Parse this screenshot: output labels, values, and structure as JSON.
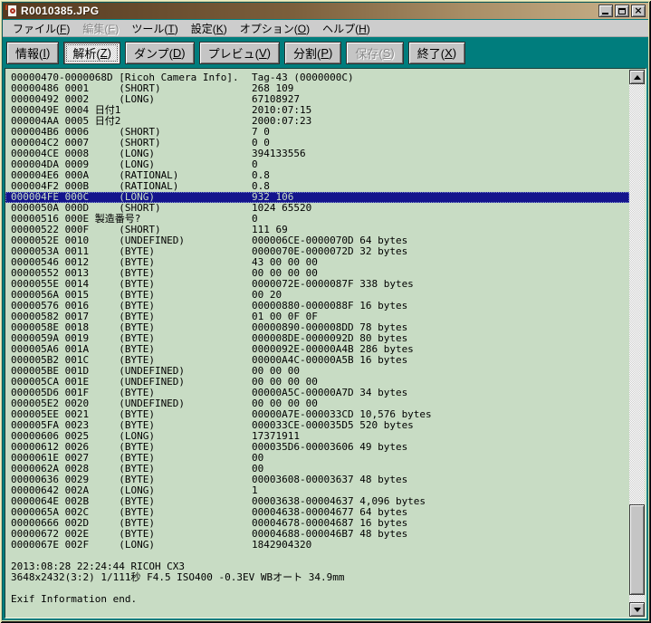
{
  "window": {
    "title": "R0010385.JPG",
    "controls": {
      "close_glyph": "×"
    }
  },
  "colors": {
    "frame_teal": "#007d7d",
    "titlebar_left": "#54391f",
    "titlebar_right": "#c9b28c",
    "menubar_bg": "#cdcdcd",
    "button_face": "#c5c5c5",
    "text_area_bg": "#c8dcc4",
    "selection_bg": "#14148c",
    "selection_fg": "#c8dcc4"
  },
  "menu": {
    "items": [
      {
        "name": "file",
        "pre": "ファイル(",
        "key": "F",
        "post": ")",
        "enabled": true
      },
      {
        "name": "edit",
        "pre": "編集(",
        "key": "E",
        "post": ")",
        "enabled": false
      },
      {
        "name": "tools",
        "pre": "ツール(",
        "key": "T",
        "post": ")",
        "enabled": true
      },
      {
        "name": "settings",
        "pre": "設定(",
        "key": "K",
        "post": ")",
        "enabled": true
      },
      {
        "name": "options",
        "pre": "オプション(",
        "key": "O",
        "post": ")",
        "enabled": true
      },
      {
        "name": "help",
        "pre": "ヘルプ(",
        "key": "H",
        "post": ")",
        "enabled": true
      }
    ]
  },
  "toolbar": {
    "buttons": [
      {
        "name": "info",
        "pre": "情報(",
        "key": "I",
        "post": ")",
        "state": "normal"
      },
      {
        "name": "analyze",
        "pre": "解析(",
        "key": "Z",
        "post": ")",
        "state": "active"
      },
      {
        "name": "dump",
        "pre": "ダンプ(",
        "key": "D",
        "post": ")",
        "state": "normal"
      },
      {
        "name": "preview",
        "pre": "プレビュ(",
        "key": "V",
        "post": ")",
        "state": "normal"
      },
      {
        "name": "split",
        "pre": "分割(",
        "key": "P",
        "post": ")",
        "state": "normal"
      },
      {
        "name": "save",
        "pre": "保存(",
        "key": "S",
        "post": ")",
        "state": "disabled"
      },
      {
        "name": "exit",
        "pre": "終了(",
        "key": "X",
        "post": ")",
        "state": "normal"
      }
    ]
  },
  "content": {
    "rows": [
      [
        "00000470-0000068D [Ricoh Camera Info].",
        "Tag-43 (0000000C)",
        0
      ],
      [
        "00000486 0001     (SHORT)",
        "268 109",
        0
      ],
      [
        "00000492 0002     (LONG)",
        "67108927",
        0
      ],
      [
        "0000049E 0004 日付1",
        "2010:07:15",
        0
      ],
      [
        "000004AA 0005 日付2",
        "2000:07:23",
        0
      ],
      [
        "000004B6 0006     (SHORT)",
        "7 0",
        0
      ],
      [
        "000004C2 0007     (SHORT)",
        "0 0",
        0
      ],
      [
        "000004CE 0008     (LONG)",
        "394133556",
        0
      ],
      [
        "000004DA 0009     (LONG)",
        "0",
        0
      ],
      [
        "000004E6 000A     (RATIONAL)",
        "0.8",
        0
      ],
      [
        "000004F2 000B     (RATIONAL)",
        "0.8",
        0
      ],
      [
        "000004FE 000C     (LONG)",
        "932 106",
        1
      ],
      [
        "0000050A 000D     (SHORT)",
        "1024 65520",
        0
      ],
      [
        "00000516 000E 製造番号?",
        "0",
        0
      ],
      [
        "00000522 000F     (SHORT)",
        "111 69",
        0
      ],
      [
        "0000052E 0010     (UNDEFINED)",
        "000006CE-0000070D 64 bytes",
        0
      ],
      [
        "0000053A 0011     (BYTE)",
        "0000070E-0000072D 32 bytes",
        0
      ],
      [
        "00000546 0012     (BYTE)",
        "43 00 00 00",
        0
      ],
      [
        "00000552 0013     (BYTE)",
        "00 00 00 00",
        0
      ],
      [
        "0000055E 0014     (BYTE)",
        "0000072E-0000087F 338 bytes",
        0
      ],
      [
        "0000056A 0015     (BYTE)",
        "00 20",
        0
      ],
      [
        "00000576 0016     (BYTE)",
        "00000880-0000088F 16 bytes",
        0
      ],
      [
        "00000582 0017     (BYTE)",
        "01 00 0F 0F",
        0
      ],
      [
        "0000058E 0018     (BYTE)",
        "00000890-000008DD 78 bytes",
        0
      ],
      [
        "0000059A 0019     (BYTE)",
        "000008DE-0000092D 80 bytes",
        0
      ],
      [
        "000005A6 001A     (BYTE)",
        "0000092E-00000A4B 286 bytes",
        0
      ],
      [
        "000005B2 001C     (BYTE)",
        "00000A4C-00000A5B 16 bytes",
        0
      ],
      [
        "000005BE 001D     (UNDEFINED)",
        "00 00 00",
        0
      ],
      [
        "000005CA 001E     (UNDEFINED)",
        "00 00 00 00",
        0
      ],
      [
        "000005D6 001F     (BYTE)",
        "00000A5C-00000A7D 34 bytes",
        0
      ],
      [
        "000005E2 0020     (UNDEFINED)",
        "00 00 00 00",
        0
      ],
      [
        "000005EE 0021     (BYTE)",
        "00000A7E-000033CD 10,576 bytes",
        0
      ],
      [
        "000005FA 0023     (BYTE)",
        "000033CE-000035D5 520 bytes",
        0
      ],
      [
        "00000606 0025     (LONG)",
        "17371911",
        0
      ],
      [
        "00000612 0026     (BYTE)",
        "000035D6-00003606 49 bytes",
        0
      ],
      [
        "0000061E 0027     (BYTE)",
        "00",
        0
      ],
      [
        "0000062A 0028     (BYTE)",
        "00",
        0
      ],
      [
        "00000636 0029     (BYTE)",
        "00003608-00003637 48 bytes",
        0
      ],
      [
        "00000642 002A     (LONG)",
        "1",
        0
      ],
      [
        "0000064E 002B     (BYTE)",
        "00003638-00004637 4,096 bytes",
        0
      ],
      [
        "0000065A 002C     (BYTE)",
        "00004638-00004677 64 bytes",
        0
      ],
      [
        "00000666 002D     (BYTE)",
        "00004678-00004687 16 bytes",
        0
      ],
      [
        "00000672 002E     (BYTE)",
        "00004688-000046B7 48 bytes",
        0
      ],
      [
        "0000067E 002F     (LONG)",
        "1842904320",
        0
      ],
      [
        "",
        "",
        0
      ],
      [
        "2013:08:28 22:24:44 RICOH CX3",
        "",
        0
      ],
      [
        "3648x2432(3:2) 1/111秒 F4.5 ISO400 -0.3EV WBオート 34.9mm",
        "",
        0
      ],
      [
        "",
        "",
        0
      ],
      [
        "Exif Information end.",
        "",
        0
      ]
    ]
  }
}
